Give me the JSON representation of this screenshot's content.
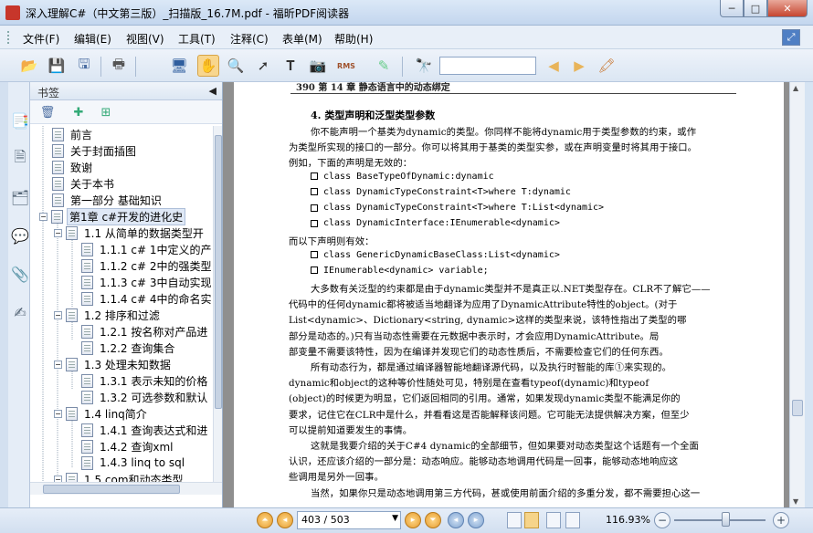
{
  "window": {
    "title": "深入理解C#（中文第三版）_扫描版_16.7M.pdf - 福昕PDF阅读器",
    "minimize_glyph": "─",
    "maximize_glyph": "□",
    "close_glyph": "✕"
  },
  "menu": [
    {
      "label": "文件(F)"
    },
    {
      "label": "编辑(E)"
    },
    {
      "label": "视图(V)"
    },
    {
      "label": "工具(T)"
    },
    {
      "label": "注释(C)"
    },
    {
      "label": "表单(M)"
    },
    {
      "label": "帮助(H)"
    }
  ],
  "toolbar": {
    "icons": [
      "open-icon",
      "save-icon",
      "save-as-icon",
      "print-icon",
      "screen-icon",
      "hand-tool-icon",
      "zoom-tool-icon",
      "select-arrow-icon",
      "text-select-icon",
      "snapshot-icon",
      "rms-icon",
      "sign-icon",
      "find-binoculars-icon",
      "prev-result-icon",
      "next-result-icon",
      "highlight-icon"
    ],
    "rms_label": "RMS",
    "search_value": "",
    "active_tool": "hand-tool-icon"
  },
  "bookmarks": {
    "header": "书签",
    "collapse_glyph": "◀",
    "items": [
      {
        "label": "前言",
        "level": 0,
        "type": "page"
      },
      {
        "label": "关于封面插图",
        "level": 0,
        "type": "page"
      },
      {
        "label": "致谢",
        "level": 0,
        "type": "page"
      },
      {
        "label": "关于本书",
        "level": 0,
        "type": "page"
      },
      {
        "label": "第一部分   基础知识",
        "level": 0,
        "type": "page"
      },
      {
        "label": "第1章   c#开发的进化史",
        "level": 0,
        "type": "folder",
        "expanded": true,
        "selected": true
      },
      {
        "label": "1.1 从简单的数据类型开",
        "level": 1,
        "type": "folder",
        "expanded": true
      },
      {
        "label": "1.1.1 c# 1中定义的产",
        "level": 2,
        "type": "page"
      },
      {
        "label": "1.1.2 c# 2中的强类型",
        "level": 2,
        "type": "page"
      },
      {
        "label": "1.1.3 c# 3中自动实现",
        "level": 2,
        "type": "page"
      },
      {
        "label": "1.1.4 c# 4中的命名实",
        "level": 2,
        "type": "page"
      },
      {
        "label": "1.2 排序和过滤",
        "level": 1,
        "type": "folder",
        "expanded": true
      },
      {
        "label": "1.2.1 按名称对产品进",
        "level": 2,
        "type": "page"
      },
      {
        "label": "1.2.2 查询集合",
        "level": 2,
        "type": "page"
      },
      {
        "label": "1.3 处理未知数据",
        "level": 1,
        "type": "folder",
        "expanded": true
      },
      {
        "label": "1.3.1 表示未知的价格",
        "level": 2,
        "type": "page"
      },
      {
        "label": "1.3.2 可选参数和默认",
        "level": 2,
        "type": "page"
      },
      {
        "label": "1.4 linq简介",
        "level": 1,
        "type": "folder",
        "expanded": true
      },
      {
        "label": "1.4.1 查询表达式和进",
        "level": 2,
        "type": "page"
      },
      {
        "label": "1.4.2 查询xml",
        "level": 2,
        "type": "page"
      },
      {
        "label": "1.4.3 linq to sql",
        "level": 2,
        "type": "page"
      },
      {
        "label": "1.5 com和动态类型",
        "level": 1,
        "type": "folder",
        "expanded": true
      }
    ]
  },
  "document": {
    "running_head": "390      第 14 章   静态语言中的动态绑定",
    "heading": "4. 类型声明和泛型类型参数",
    "lines": [
      {
        "text": "你不能声明一个基类为dynamic的类型。你同样不能将dynamic用于类型参数的约束，或作",
        "kind": "indent"
      },
      {
        "text": "为类型所实现的接口的一部分。你可以将其用于基类的类型实参，或在声明变量时将其用于接口。",
        "kind": "normal"
      },
      {
        "text": "例如，下面的声明是无效的：",
        "kind": "normal"
      },
      {
        "text": "class BaseTypeOfDynamic:dynamic",
        "kind": "code"
      },
      {
        "text": "class DynamicTypeConstraint<T>where T:dynamic",
        "kind": "code"
      },
      {
        "text": "class DynamicTypeConstraint<T>where T:List<dynamic>",
        "kind": "code"
      },
      {
        "text": "class DynamicInterface:IEnumerable<dynamic>",
        "kind": "code"
      },
      {
        "text": "而以下声明则有效：",
        "kind": "normal"
      },
      {
        "text": "class GenericDynamicBaseClass:List<dynamic>",
        "kind": "code"
      },
      {
        "text": "IEnumerable<dynamic> variable;",
        "kind": "code"
      },
      {
        "text": "大多数有关泛型的约束都是由于dynamic类型并不是真正以.NET类型存在。CLR不了解它——",
        "kind": "indent"
      },
      {
        "text": "代码中的任何dynamic都将被适当地翻译为应用了DynamicAttribute特性的object。(对于",
        "kind": "normal"
      },
      {
        "text": "List<dynamic>、Dictionary<string, dynamic>这样的类型来说，该特性指出了类型的哪",
        "kind": "normal"
      },
      {
        "text": "部分是动态的。)只有当动态性需要在元数据中表示时，才会应用DynamicAttribute。局",
        "kind": "normal"
      },
      {
        "text": "部变量不需要该特性，因为在编译并发现它们的动态性质后，不需要检查它们的任何东西。",
        "kind": "normal"
      },
      {
        "text": "所有动态行为，都是通过编译器智能地翻译源代码，以及执行时智能的库①来实现的。",
        "kind": "indent"
      },
      {
        "text": "dynamic和object的这种等价性随处可见，特别是在查看typeof(dynamic)和typeof",
        "kind": "normal"
      },
      {
        "text": "(object)的时候更为明显，它们返回相同的引用。通常，如果发现dynamic类型不能满足你的",
        "kind": "normal"
      },
      {
        "text": "要求，记住它在CLR中是什么，并看看这是否能解释该问题。它可能无法提供解决方案，但至少",
        "kind": "normal"
      },
      {
        "text": "可以提前知道要发生的事情。",
        "kind": "normal"
      },
      {
        "text": "这就是我要介绍的关于C#4 dynamic的全部细节，但如果要对动态类型这个话题有一个全面",
        "kind": "indent"
      },
      {
        "text": "认识，还应该介绍的一部分是：动态响应。能够动态地调用代码是一回事，能够动态地响应这",
        "kind": "normal"
      },
      {
        "text": "些调用是另外一回事。",
        "kind": "normal"
      },
      {
        "text": "当然，如果你只是动态地调用第三方代码，甚或使用前面介绍的多重分发，都不需要担心这一",
        "kind": "indent"
      }
    ]
  },
  "status": {
    "page_display": "403 / 503",
    "zoom": "116.93%",
    "zoom_out_glyph": "−",
    "zoom_in_glyph": "+"
  }
}
